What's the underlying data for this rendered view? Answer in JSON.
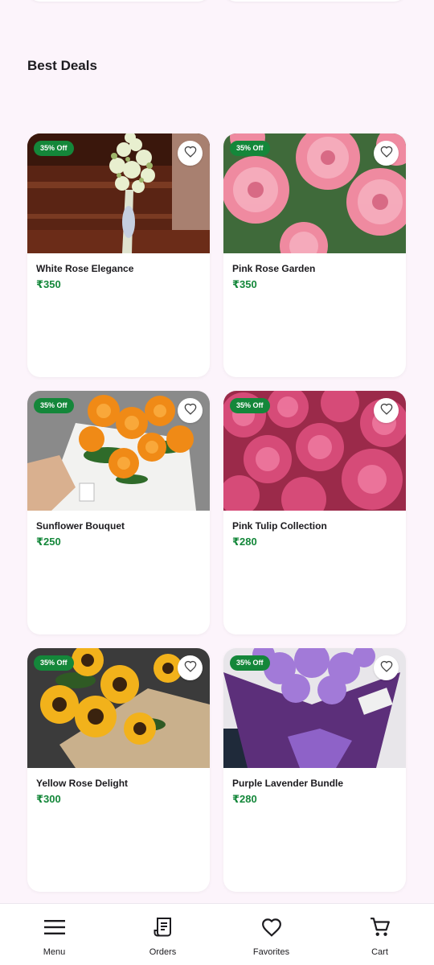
{
  "section": {
    "title": "Best Deals"
  },
  "products": [
    {
      "name": "White Rose Elegance",
      "price": "₹350",
      "badge": "35% Off",
      "image_icon": "white-flower-bouquet-image"
    },
    {
      "name": "Pink Rose Garden",
      "price": "₹350",
      "badge": "35% Off",
      "image_icon": "pink-carnation-image"
    },
    {
      "name": "Sunflower Bouquet",
      "price": "₹250",
      "badge": "35% Off",
      "image_icon": "marigold-bouquet-image"
    },
    {
      "name": "Pink Tulip Collection",
      "price": "₹280",
      "badge": "35% Off",
      "image_icon": "pink-ranunculus-image"
    },
    {
      "name": "Yellow Rose Delight",
      "price": "₹300",
      "badge": "35% Off",
      "image_icon": "sunflower-bouquet-image"
    },
    {
      "name": "Purple Lavender Bundle",
      "price": "₹280",
      "badge": "35% Off",
      "image_icon": "purple-flower-bouquet-image"
    }
  ],
  "bottom_nav": [
    {
      "label": "Menu",
      "icon": "menu-icon"
    },
    {
      "label": "Orders",
      "icon": "receipt-icon"
    },
    {
      "label": "Favorites",
      "icon": "heart-icon"
    },
    {
      "label": "Cart",
      "icon": "cart-icon"
    }
  ],
  "colors": {
    "background": "#fcf4fb",
    "accent_green": "#14873a",
    "card": "#ffffff"
  }
}
